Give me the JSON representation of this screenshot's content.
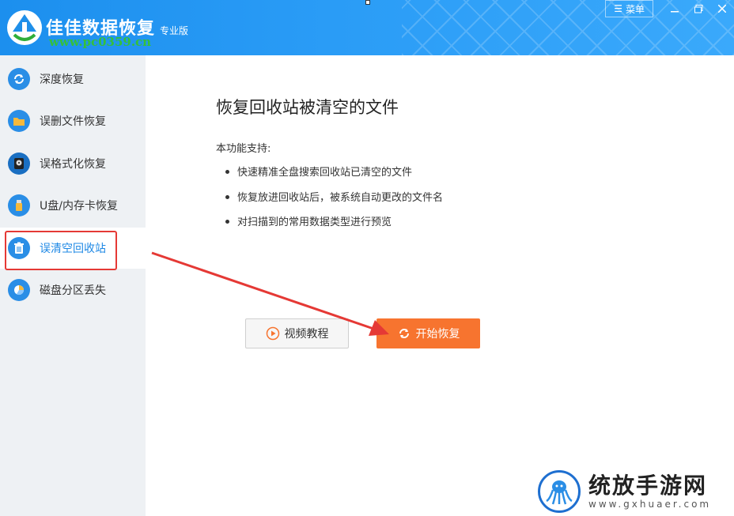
{
  "app": {
    "name": "佳佳数据恢复",
    "edition": "专业版",
    "watermark_url": "www.pc0359.cn"
  },
  "window": {
    "menu_label": "菜单"
  },
  "sidebar": {
    "items": [
      {
        "label": "深度恢复",
        "icon": "refresh-icon"
      },
      {
        "label": "误删文件恢复",
        "icon": "folder-icon"
      },
      {
        "label": "误格式化恢复",
        "icon": "disk-icon"
      },
      {
        "label": "U盘/内存卡恢复",
        "icon": "usb-icon"
      },
      {
        "label": "误清空回收站",
        "icon": "recycle-bin-icon",
        "active": true
      },
      {
        "label": "磁盘分区丢失",
        "icon": "pie-chart-icon"
      }
    ]
  },
  "main": {
    "title": "恢复回收站被清空的文件",
    "support_label": "本功能支持:",
    "features": [
      "快速精准全盘搜索回收站已清空的文件",
      "恢复放进回收站后，被系统自动更改的文件名",
      "对扫描到的常用数据类型进行预览"
    ],
    "video_button": "视频教程",
    "start_button": "开始恢复"
  },
  "corner_watermark": {
    "title": "统放手游网",
    "url": "www.gxhuaer.com"
  },
  "colors": {
    "titlebar": "#2a9cf6",
    "accent": "#1e88e5",
    "start_button": "#f7742f",
    "annotation_red": "#e53935"
  }
}
